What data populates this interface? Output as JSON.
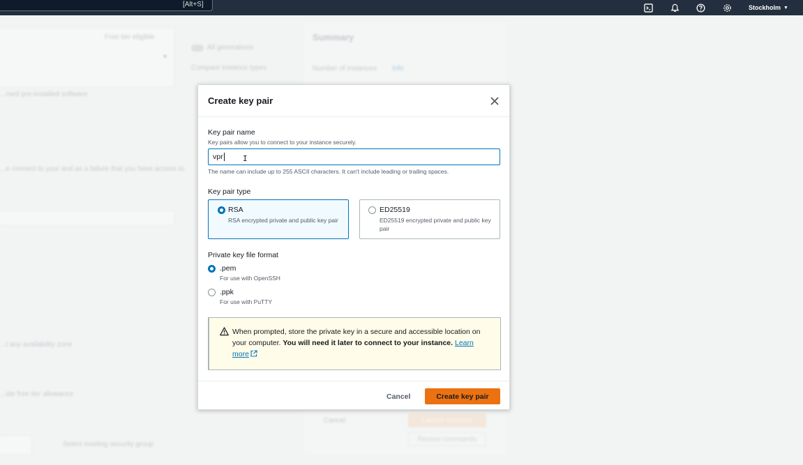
{
  "topbar": {
    "search_shortcut": "[Alt+S]",
    "region": "Stockholm",
    "icons": [
      "cloudshell-icon",
      "bell-icon",
      "help-icon",
      "gear-icon"
    ]
  },
  "background": {
    "free_tier": "Free tier eligible",
    "all_generations": "All generations",
    "compare_types": "Compare instance types",
    "preinstalled": "...med pre-installed software",
    "connect_note": "...e connect to your and as a failure that you have access to",
    "availability": "...t any availability zone",
    "free_tier_allowance": "...ide free tier allowance",
    "select_group": "Select existing security group",
    "summary_title": "Summary",
    "number_instances": "Number of instances",
    "info": "Info",
    "cancel": "Cancel",
    "launch": "Launch instance",
    "review": "Review commands"
  },
  "modal": {
    "title": "Create key pair",
    "name_label": "Key pair name",
    "name_desc": "Key pairs allow you to connect to your instance securely.",
    "name_value": "vpr",
    "name_hint": "The name can include up to 255 ASCII characters. It can't include leading or trailing spaces.",
    "type_label": "Key pair type",
    "types": [
      {
        "title": "RSA",
        "desc": "RSA encrypted private and public key pair",
        "selected": true
      },
      {
        "title": "ED25519",
        "desc": "ED25519 encrypted private and public key pair",
        "selected": false
      }
    ],
    "format_label": "Private key file format",
    "formats": [
      {
        "title": ".pem",
        "desc": "For use with OpenSSH",
        "selected": true
      },
      {
        "title": ".ppk",
        "desc": "For use with PuTTY",
        "selected": false
      }
    ],
    "alert": {
      "text_plain": "When prompted, store the private key in a secure and accessible location on your computer. ",
      "text_bold": "You will need it later to connect to your instance.",
      "link": "Learn more"
    },
    "cancel_label": "Cancel",
    "create_label": "Create key pair"
  },
  "colors": {
    "topbar": "#232f3e",
    "accent": "#0073bb",
    "primary_button": "#ec7211",
    "alert_bg": "#fffce9"
  }
}
